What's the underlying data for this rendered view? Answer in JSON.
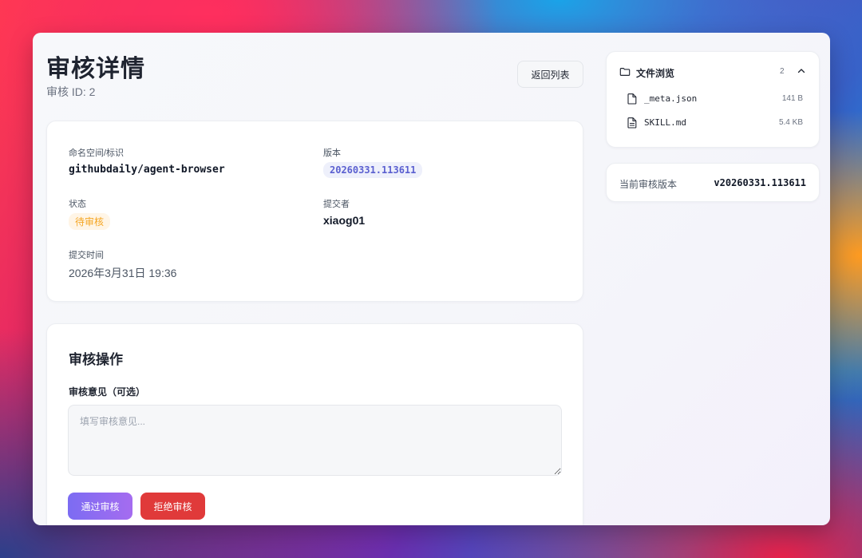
{
  "header": {
    "title": "审核详情",
    "subtitle": "审核 ID: 2",
    "back_label": "返回列表"
  },
  "info": {
    "namespace_label": "命名空间/标识",
    "namespace_value": "githubdaily/agent-browser",
    "version_label": "版本",
    "version_value": "20260331.113611",
    "status_label": "状态",
    "status_value": "待审核",
    "submitter_label": "提交者",
    "submitter_value": "xiaog01",
    "submit_time_label": "提交时间",
    "submit_time_value": "2026年3月31日 19:36"
  },
  "actions": {
    "title": "审核操作",
    "comment_label": "审核意见（可选）",
    "comment_placeholder": "填写审核意见...",
    "comment_value": "",
    "approve_label": "通过审核",
    "reject_label": "拒绝审核"
  },
  "files": {
    "header_label": "文件浏览",
    "count": "2",
    "items": [
      {
        "name": "_meta.json",
        "size": "141 B"
      },
      {
        "name": "SKILL.md",
        "size": "5.4 KB"
      }
    ]
  },
  "current_version": {
    "label": "当前审核版本",
    "value": "v20260331.113611"
  },
  "icons": {
    "folder": "folder-icon",
    "collapse": "chevron-up-icon",
    "file": "file-icon",
    "doc": "document-icon"
  },
  "colors": {
    "accent": "#7c6cf2",
    "danger": "#e03a3a",
    "pending": "#f5a623",
    "version_badge": "#5a5fd0"
  }
}
